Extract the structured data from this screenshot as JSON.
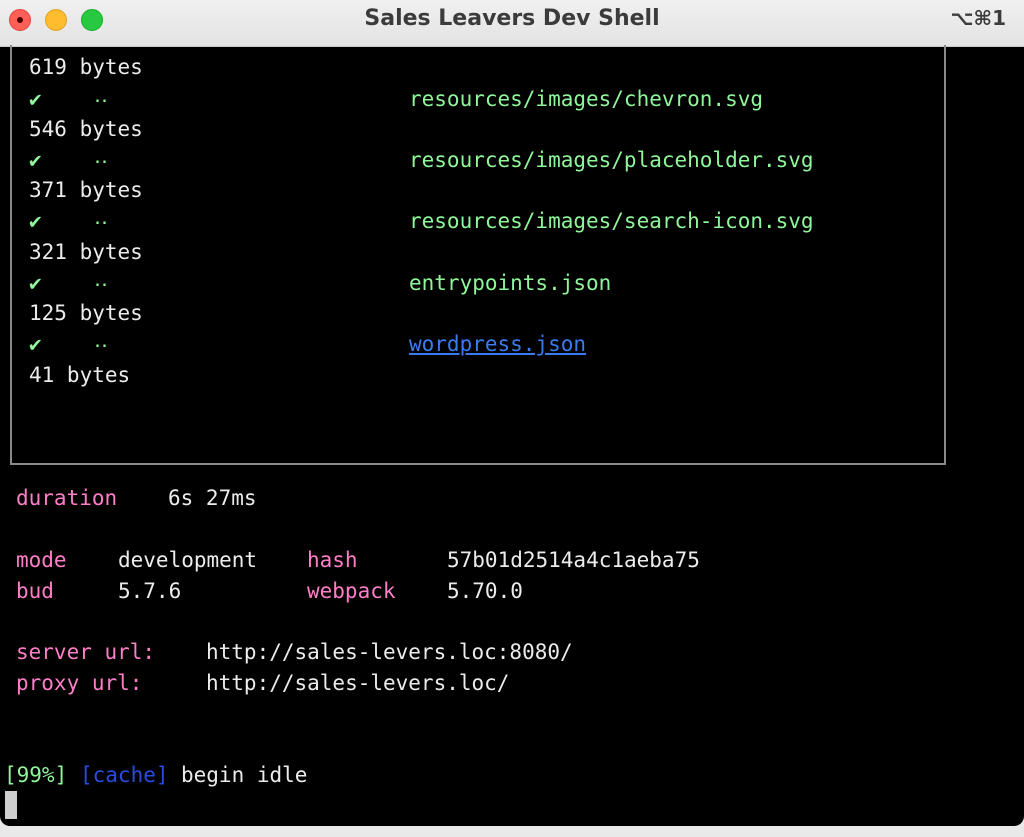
{
  "window": {
    "title": "Sales Leavers Dev Shell",
    "shortcut": "⌥⌘1"
  },
  "assets": [
    {
      "size": "619 bytes"
    },
    {
      "check": "✔",
      "dots": "‥",
      "file": "resources/images/chevron.svg",
      "size": "546 bytes"
    },
    {
      "check": "✔",
      "dots": "‥",
      "file": "resources/images/placeholder.svg",
      "size": "371 bytes"
    },
    {
      "check": "✔",
      "dots": "‥",
      "file": "resources/images/search-icon.svg",
      "size": "321 bytes"
    },
    {
      "check": "✔",
      "dots": "‥",
      "file": "entrypoints.json",
      "size": "125 bytes"
    },
    {
      "check": "✔",
      "dots": "‥",
      "file": "wordpress.json",
      "size": "41 bytes"
    }
  ],
  "summary": {
    "duration_label": "duration",
    "duration_value": "6s 27ms",
    "mode_label": "mode",
    "mode_value": "development",
    "hash_label": "hash",
    "hash_value": "57b01d2514a4c1aeba75",
    "bud_label": "bud",
    "bud_value": "5.7.6",
    "webpack_label": "webpack",
    "webpack_value": "5.70.0",
    "server_label": "server url:",
    "server_value": "http://sales-levers.loc:8080/",
    "proxy_label": "proxy url:",
    "proxy_value": "http://sales-levers.loc/"
  },
  "status": {
    "progress": "[99%]",
    "tag": "[cache]",
    "message": "begin idle"
  },
  "colors": {
    "green": "#8ff79a",
    "pink": "#ff7ec8",
    "link": "#3a7cf0",
    "tag_blue": "#2a4ce0"
  }
}
